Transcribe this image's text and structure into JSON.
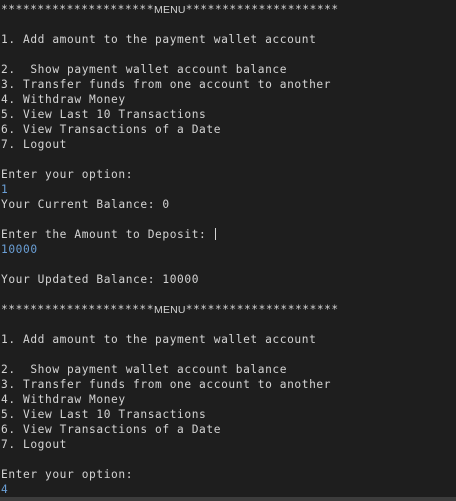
{
  "menu_banner": {
    "left": "*********************",
    "word": "MENU",
    "right": "*********************"
  },
  "menu_items": [
    "1. Add amount to the payment wallet account",
    "2.  Show payment wallet account balance",
    "3. Transfer funds from one account to another",
    "4. Withdraw Money",
    "5. View Last 10 Transactions",
    "6. View Transactions of a Date",
    "7. Logout"
  ],
  "prompts": {
    "option": "Enter your option:",
    "deposit": "Enter the Amount to Deposit: "
  },
  "session": {
    "first_option": "1",
    "current_balance": "Your Current Balance: 0",
    "deposit_amount": "10000",
    "updated_balance": "Your Updated Balance: 10000",
    "second_option": "4"
  },
  "colors": {
    "background": "#1e1e1e",
    "text": "#d4d4d4",
    "user_input": "#6a9fd6"
  }
}
